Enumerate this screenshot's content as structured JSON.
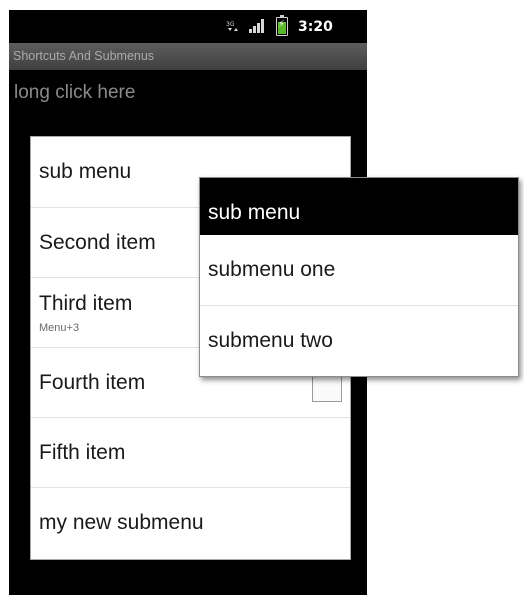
{
  "status_bar": {
    "time": "3:20",
    "icons": [
      "network-data-icon",
      "signal-icon",
      "battery-charging-icon"
    ]
  },
  "app": {
    "title": "Shortcuts And Submenus",
    "hint": "long click here"
  },
  "options_menu": {
    "items": [
      {
        "label": "sub menu"
      },
      {
        "label": "Second item"
      },
      {
        "label": "Third item",
        "shortcut": "Menu+3"
      },
      {
        "label": "Fourth item",
        "checkbox": true,
        "checked": false
      },
      {
        "label": "Fifth item"
      },
      {
        "label": "my new submenu"
      }
    ]
  },
  "submenu": {
    "title": "sub menu",
    "items": [
      {
        "label": "submenu one"
      },
      {
        "label": "submenu two"
      }
    ]
  }
}
